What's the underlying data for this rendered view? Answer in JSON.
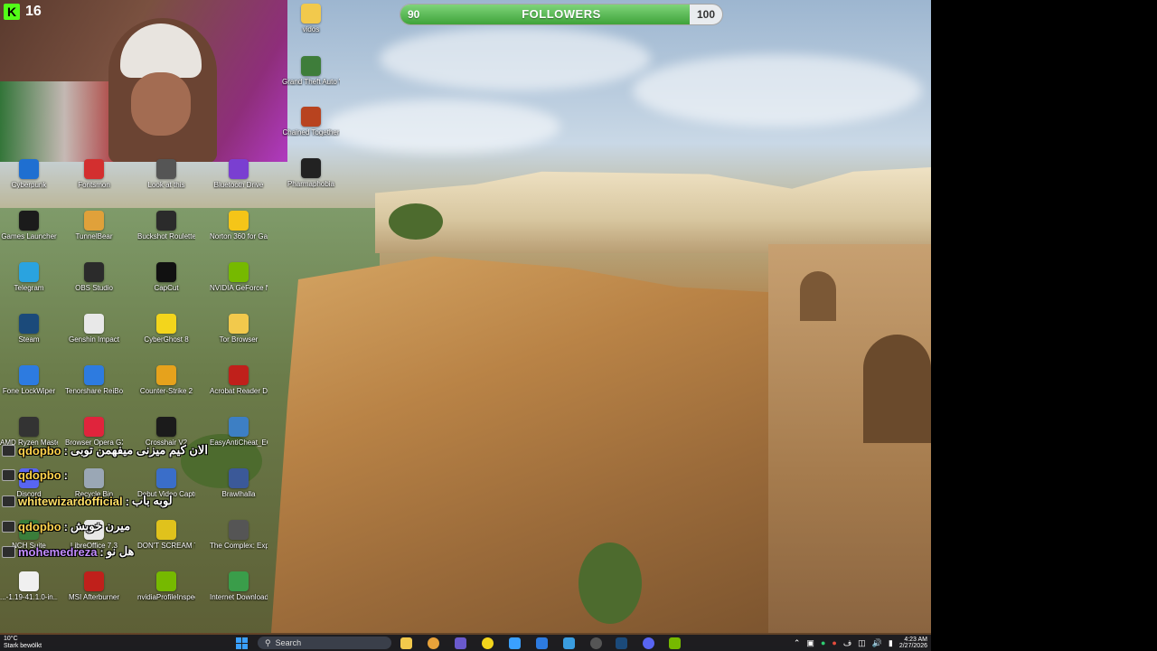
{
  "stream": {
    "platform_icon": "kick-logo",
    "viewer_count": "16",
    "followers_goal": {
      "label": "FOLLOWERS",
      "current": 90,
      "target": 100
    }
  },
  "desktop_icons": [
    {
      "label": "vidos",
      "icon": "folder-icon",
      "color": "#f2c94c"
    },
    {
      "label": "Grand Theft Auto V Legacy",
      "icon": "gta-icon",
      "color": "#3e7d3a"
    },
    {
      "label": "Chained Together",
      "icon": "chained-together-icon",
      "color": "#b8431f"
    },
    {
      "label": "Pharmaphobia",
      "icon": "pharmaphobia-icon",
      "color": "#222222"
    },
    {
      "label": "Cyberpunk",
      "icon": "app-icon",
      "color": "#1f6fd1"
    },
    {
      "label": "Fontsmon",
      "icon": "app-icon",
      "color": "#d32f2f"
    },
    {
      "label": "Look at this",
      "icon": "app-icon",
      "color": "#555555"
    },
    {
      "label": "Bluetooth Drive",
      "icon": "app-icon",
      "color": "#7a3fd1"
    },
    {
      "label": "Games Launcher",
      "icon": "epic-games-icon",
      "color": "#1b1b1b"
    },
    {
      "label": "TunnelBear",
      "icon": "tunnelbear-icon",
      "color": "#e0a13a"
    },
    {
      "label": "Buckshot Roulette",
      "icon": "buckshot-roulette-icon",
      "color": "#2b2b2b"
    },
    {
      "label": "Norton 360 for Gamers",
      "icon": "norton-icon",
      "color": "#f5c518"
    },
    {
      "label": "Telegram",
      "icon": "telegram-icon",
      "color": "#2aa3df"
    },
    {
      "label": "OBS Studio",
      "icon": "obs-icon",
      "color": "#2b2b2b"
    },
    {
      "label": "CapCut",
      "icon": "capcut-icon",
      "color": "#111111"
    },
    {
      "label": "NVIDIA GeForce NOW",
      "icon": "nvidia-icon",
      "color": "#76b900"
    },
    {
      "label": "Steam",
      "icon": "steam-icon",
      "color": "#1b4a7a"
    },
    {
      "label": "Genshin Impact",
      "icon": "genshin-icon",
      "color": "#e8e8e8"
    },
    {
      "label": "CyberGhost 8",
      "icon": "cyberghost-icon",
      "color": "#f3d51c"
    },
    {
      "label": "Tor Browser",
      "icon": "folder-icon",
      "color": "#f2c94c"
    },
    {
      "label": "Fone LockWiper",
      "icon": "lockwiper-icon",
      "color": "#2d7be0"
    },
    {
      "label": "Tenorshare ReiBoot",
      "icon": "reiboot-icon",
      "color": "#2d7be0"
    },
    {
      "label": "Counter-Strike 2",
      "icon": "cs2-icon",
      "color": "#e6a21c"
    },
    {
      "label": "Acrobat Reader DC",
      "icon": "acrobat-icon",
      "color": "#c0201b"
    },
    {
      "label": "AMD Ryzen Master",
      "icon": "amd-icon",
      "color": "#333333"
    },
    {
      "label": "Browser Opera GX",
      "icon": "opera-gx-icon",
      "color": "#e0243c"
    },
    {
      "label": "Crosshair V2",
      "icon": "crosshair-icon",
      "color": "#1b1b1b"
    },
    {
      "label": "EasyAntiCheat_EOS",
      "icon": "eac-icon",
      "color": "#3d7fc4"
    },
    {
      "label": "Discord",
      "icon": "discord-icon",
      "color": "#5865f2"
    },
    {
      "label": "Recycle Bin",
      "icon": "recycle-bin-icon",
      "color": "#9aa7b5"
    },
    {
      "label": "Debut Video Capture",
      "icon": "debut-icon",
      "color": "#3a6ec9"
    },
    {
      "label": "Brawlhalla",
      "icon": "brawlhalla-icon",
      "color": "#3b5998"
    },
    {
      "label": "NCH Suite",
      "icon": "nch-icon",
      "color": "#3a7d3a"
    },
    {
      "label": "LibreOffice 7.3",
      "icon": "libreoffice-icon",
      "color": "#e8e8e8"
    },
    {
      "label": "DON'T SCREAM TOGETHER",
      "icon": "dont-scream-icon",
      "color": "#e0c21c"
    },
    {
      "label": "The Complex: Expedition",
      "icon": "complex-icon",
      "color": "#555555"
    },
    {
      "label": "...-1.19-41.1.0-in... (1)",
      "icon": "file-icon",
      "color": "#f0f0f0"
    },
    {
      "label": "MSI Afterburner",
      "icon": "afterburner-icon",
      "color": "#c0201b"
    },
    {
      "label": "nvidiaProfileInspector",
      "icon": "nvidia-inspector-icon",
      "color": "#76b900"
    },
    {
      "label": "Internet Download Manager",
      "icon": "idm-icon",
      "color": "#3a9d4a"
    }
  ],
  "chat": [
    {
      "user": "qdopbo",
      "sep": " : ",
      "msg": "الان كيم ميزنى ميفهمن توبى",
      "user_color": "#ffd34d"
    },
    {
      "user": "qdopbo",
      "sep": " : ",
      "msg": "",
      "user_color": "#ffd34d"
    },
    {
      "user": "whitewizardofficial",
      "sep": " : ",
      "msg": "لوبه باب",
      "user_color": "#ffe066"
    },
    {
      "user": "qdopbo",
      "sep": " : ",
      "msg": "ميرن خوبش",
      "user_color": "#ffd34d"
    },
    {
      "user": "mohemedreza",
      "sep": " : ",
      "msg": "هل نو",
      "user_color": "#c38cff"
    }
  ],
  "taskbar": {
    "weather_temp": "10°C",
    "weather_desc": "Stark bewölkt",
    "search_placeholder": "Search",
    "time": "4:23 AM",
    "date": "2/27/2026"
  }
}
